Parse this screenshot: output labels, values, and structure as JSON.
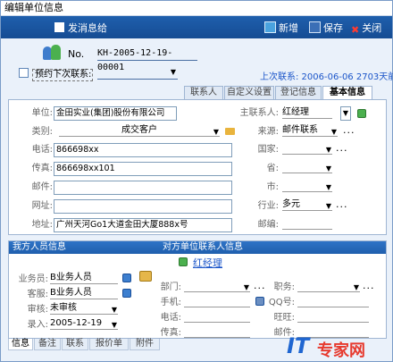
{
  "window": {
    "title": "编辑单位信息"
  },
  "toolbar": {
    "send_label": "发消息给",
    "new_label": "新增",
    "save_label": "保存",
    "close_label": "关闭"
  },
  "header": {
    "no_label": "No.",
    "no_value": "KH-2005-12-19-00001",
    "remind_label": "预约下次联系:",
    "last_contact": "上次联系: 2006-06-06 2703天前"
  },
  "tabs": [
    "联系人",
    "自定义设置",
    "登记信息",
    "基本信息"
  ],
  "basic": {
    "unit_label": "单位:",
    "unit_value": "金田实业(集团)股份有限公司",
    "category_label": "类别:",
    "category_value": "成交客户",
    "phone_label": "电话:",
    "phone_value": "866698xx",
    "fax_label": "传真:",
    "fax_value": "866698xx101",
    "email_label": "邮件:",
    "email_value": "",
    "website_label": "网址:",
    "website_value": "",
    "address_label": "地址:",
    "address_value": "广州天河Go1大道金田大厦888x号",
    "main_contact_label": "主联系人:",
    "main_contact_value": "红经理",
    "source_label": "来源:",
    "source_value": "邮件联系",
    "country_label": "国家:",
    "province_label": "省:",
    "city_label": "市:",
    "industry_label": "行业:",
    "industry_value": "多元",
    "zip_label": "邮编:"
  },
  "staff": {
    "section_title": "我方人员信息",
    "salesperson_label": "业务员:",
    "salesperson_value": "B业务人员",
    "service_label": "客服:",
    "service_value": "B业务人员",
    "audit_label": "审核:",
    "audit_value": "未审核",
    "entry_label": "录入:",
    "entry_value": "2005-12-19"
  },
  "contact": {
    "section_title": "对方单位联系人信息",
    "name": "红经理",
    "dept_label": "部门:",
    "title_label": "职务:",
    "mobile_label": "手机:",
    "qq_label": "QQ号:",
    "phone_label": "电话:",
    "wangwang_label": "旺旺:",
    "fax_label": "传真:",
    "email_label": "邮件:"
  },
  "bottom_tabs": [
    "信息",
    "备注",
    "联系",
    "报价单",
    "附件"
  ],
  "watermark": {
    "brand": "IT",
    "text": "专家网"
  },
  "colors": {
    "toolbar": "#1f5fad",
    "link": "#1b55c9",
    "background": "#eaf1fa"
  }
}
